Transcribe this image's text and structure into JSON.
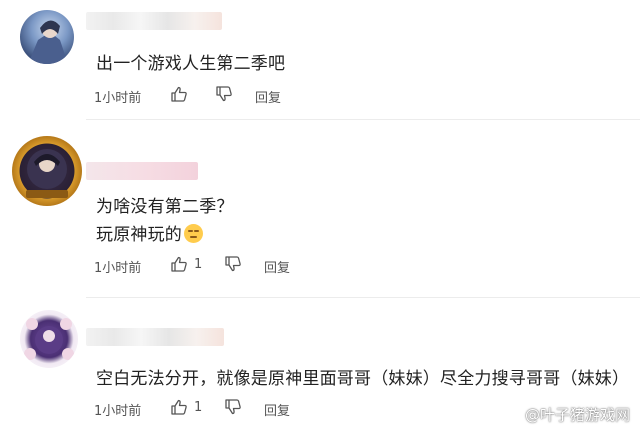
{
  "comments": [
    {
      "lines": [
        "出一个游戏人生第二季吧"
      ],
      "time": "1小时前",
      "like_count": "",
      "reply_label": "回复"
    },
    {
      "lines": [
        "为啥没有第二季？",
        "玩原神玩的"
      ],
      "emoji": "face-with-smirk-emoji",
      "time": "1小时前",
      "like_count": "1",
      "reply_label": "回复"
    },
    {
      "lines": [
        "空白无法分开，就像是原神里面哥哥（妹妹）尽全力搜寻哥哥（妹妹）"
      ],
      "time": "1小时前",
      "like_count": "1",
      "reply_label": "回复"
    }
  ],
  "watermark": "@叶子猪游戏网",
  "colors": {
    "meta_text": "#555555",
    "divider": "#ececec",
    "badge_gold": "#d79a2b"
  }
}
